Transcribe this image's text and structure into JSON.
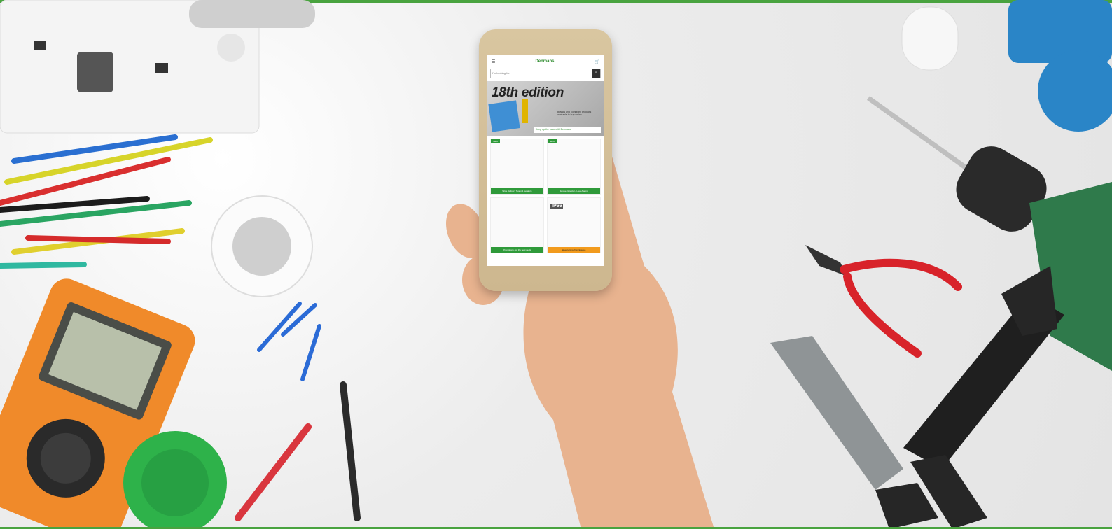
{
  "phone": {
    "logo_text": "Denmans",
    "search_placeholder": "I'm looking for",
    "hero": {
      "title": "18th edition",
      "subtitle": "Brands and compliant products available to buy online",
      "footer": "Keep up the pace with Denmans"
    },
    "tiles": [
      {
        "badge": "NEW",
        "caption": "Wide Delivery Tegan 1 Isolators"
      },
      {
        "badge": "NEW",
        "caption": "Smoke Detector / Heat Alarms"
      },
      {
        "badge": "",
        "caption": "Promotions are the best deals"
      },
      {
        "badge": "",
        "label": "IP66",
        "caption": "Weatherproof Enclosures"
      }
    ]
  },
  "colors": {
    "accent_green": "#49a33f",
    "tile_orange": "#f29b1e"
  }
}
